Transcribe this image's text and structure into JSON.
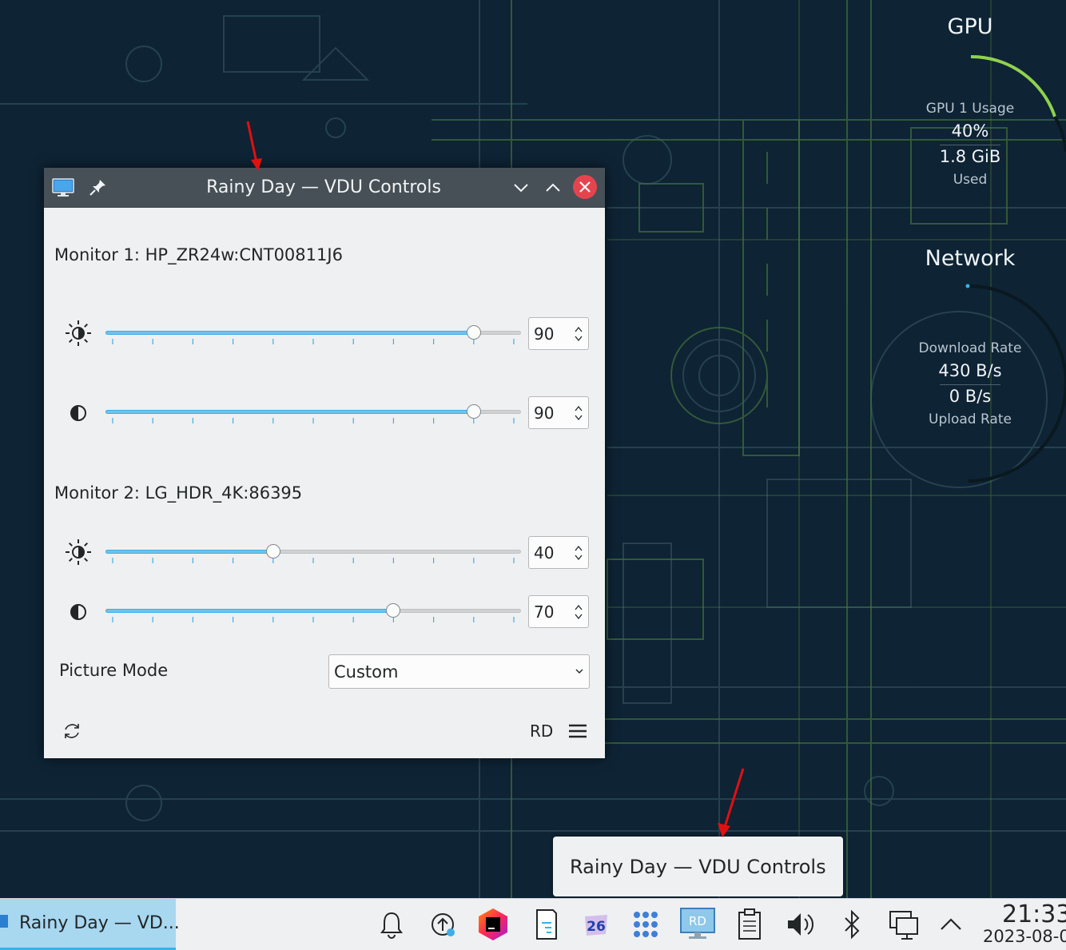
{
  "window": {
    "title": "Rainy Day — VDU Controls",
    "app_icon": "monitor-icon",
    "buttons": [
      "pin-icon",
      "minimize-icon",
      "maximize-icon",
      "close-icon"
    ]
  },
  "monitors": [
    {
      "label": "Monitor 1: HP_ZR24w:CNT00811J6",
      "brightness": 90,
      "contrast": 90
    },
    {
      "label": "Monitor 2: LG_HDR_4K:86395",
      "brightness": 40,
      "contrast": 70
    }
  ],
  "picture_mode": {
    "label": "Picture Mode",
    "value": "Custom"
  },
  "footer": {
    "preset": "RD",
    "refresh_icon": "refresh-icon",
    "menu_icon": "hamburger-menu-icon"
  },
  "tooltip": {
    "text": "Rainy Day — VDU Controls"
  },
  "widgets": {
    "gpu": {
      "title": "GPU",
      "usage_label": "GPU 1 Usage",
      "usage_value": "40%",
      "mem_value": "1.8 GiB",
      "mem_label": "Used",
      "usage_fraction": 0.4
    },
    "network": {
      "title": "Network",
      "down_label": "Download Rate",
      "down_value": "430 B/s",
      "up_value": "0 B/s",
      "up_label": "Upload Rate"
    }
  },
  "taskbar": {
    "task_label": "Rainy Day — VD...",
    "tray_icons": [
      "bell-icon",
      "update-icon",
      "jetbrains-toolbox-icon",
      "clipboard-note-icon",
      "calendar-26-icon",
      "app-grid-icon",
      "vdu-controls-tray-icon",
      "clipboard-icon",
      "volume-icon",
      "bluetooth-icon",
      "network-icon",
      "chevron-up-icon"
    ],
    "calendar_day": "26",
    "vdu_tray_text": "RD",
    "clock_time": "21:33",
    "clock_date": "2023-08-0"
  },
  "colors": {
    "accent": "#3daee9",
    "close": "#e5444e",
    "titlebar": "#475057",
    "annotation_arrow": "#e01010"
  }
}
